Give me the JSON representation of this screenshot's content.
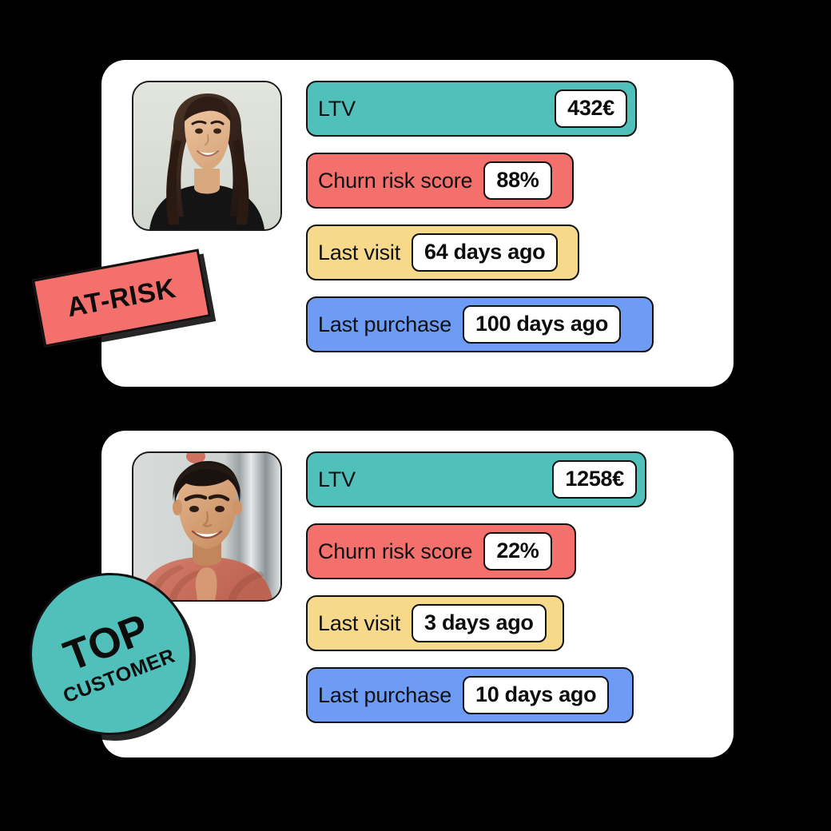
{
  "cards": [
    {
      "id": "at-risk",
      "badge": {
        "type": "rect",
        "label": "AT-RISK",
        "color": "#F4706C"
      },
      "avatar": {
        "alt": "smiling woman with long dark hair",
        "background": "#d9ddd6"
      },
      "metrics": [
        {
          "label": "LTV",
          "value": "432€",
          "color": "#52C0BA"
        },
        {
          "label": "Churn risk score",
          "value": "88%",
          "color": "#F4706C"
        },
        {
          "label": "Last visit",
          "value": "64 days ago",
          "color": "#F6D98B"
        },
        {
          "label": "Last purchase",
          "value": "100 days ago",
          "color": "#6E9CF4"
        }
      ]
    },
    {
      "id": "top-customer",
      "badge": {
        "type": "circle",
        "label_line1": "TOP",
        "label_line2": "CUSTOMER",
        "color": "#52C0BA"
      },
      "avatar": {
        "alt": "smiling young man in salmon shirt",
        "background": "#cfd3d2"
      },
      "metrics": [
        {
          "label": "LTV",
          "value": "1258€",
          "color": "#52C0BA"
        },
        {
          "label": "Churn risk score",
          "value": "22%",
          "color": "#F4706C"
        },
        {
          "label": "Last visit",
          "value": "3 days ago",
          "color": "#F6D98B"
        },
        {
          "label": "Last purchase",
          "value": "10 days ago",
          "color": "#6E9CF4"
        }
      ]
    }
  ],
  "palette": {
    "background": "#000000",
    "card": "#FFFFFF",
    "teal": "#52C0BA",
    "red": "#F4706C",
    "yellow": "#F6D98B",
    "blue": "#6E9CF4",
    "ink": "#111111"
  }
}
